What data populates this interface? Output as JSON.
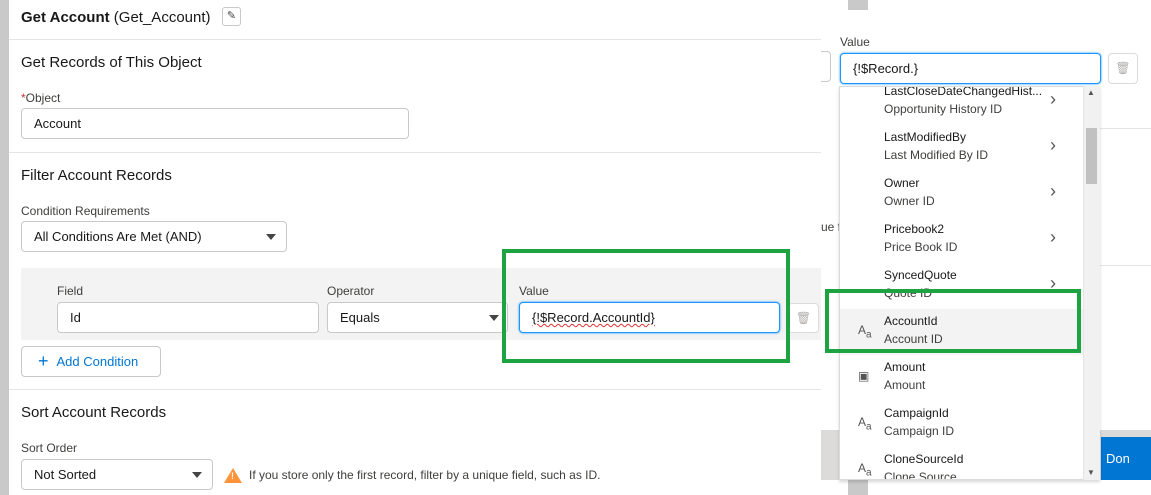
{
  "header": {
    "title_bold": "Get Account",
    "title_api": "(Get_Account)",
    "edit_icon": "pencil-icon"
  },
  "get_records": {
    "section_title": "Get Records of This Object",
    "object_label": "Object",
    "object_required_mark": "*",
    "object_value": "Account"
  },
  "filter": {
    "section_title": "Filter Account Records",
    "condition_label": "Condition Requirements",
    "condition_value": "All Conditions Are Met (AND)",
    "field_label": "Field",
    "field_value": "Id",
    "operator_label": "Operator",
    "operator_value": "Equals",
    "value_label": "Value",
    "value_value": "{!$Record.AccountId}",
    "add_condition_label": "Add Condition"
  },
  "sort": {
    "section_title": "Sort Account Records",
    "order_label": "Sort Order",
    "order_value": "Not Sorted",
    "warning_text": "If you store only the first record, filter by a unique field, such as ID."
  },
  "right_panel": {
    "value_label": "Value",
    "value_input": "{!$Record.}",
    "partial_text": "ue f",
    "done_label": "Don",
    "items": [
      {
        "name": "LastCloseDateChangedHist...",
        "sub": "Opportunity History ID",
        "has_chevron": true,
        "icon": ""
      },
      {
        "name": "LastModifiedBy",
        "sub": "Last Modified By ID",
        "has_chevron": true,
        "icon": ""
      },
      {
        "name": "Owner",
        "sub": "Owner ID",
        "has_chevron": true,
        "icon": ""
      },
      {
        "name": "Pricebook2",
        "sub": "Price Book ID",
        "has_chevron": true,
        "icon": ""
      },
      {
        "name": "SyncedQuote",
        "sub": "Quote ID",
        "has_chevron": true,
        "icon": ""
      },
      {
        "name": "AccountId",
        "sub": "Account ID",
        "has_chevron": false,
        "icon": "text-type-icon"
      },
      {
        "name": "Amount",
        "sub": "Amount",
        "has_chevron": false,
        "icon": "currency-type-icon"
      },
      {
        "name": "CampaignId",
        "sub": "Campaign ID",
        "has_chevron": false,
        "icon": "text-type-icon"
      },
      {
        "name": "CloneSourceId",
        "sub": "Clone Source",
        "has_chevron": false,
        "icon": "text-type-icon"
      }
    ]
  },
  "colors": {
    "highlight": "#1ea342",
    "brand": "#0176d3",
    "warning": "#fe9339"
  }
}
